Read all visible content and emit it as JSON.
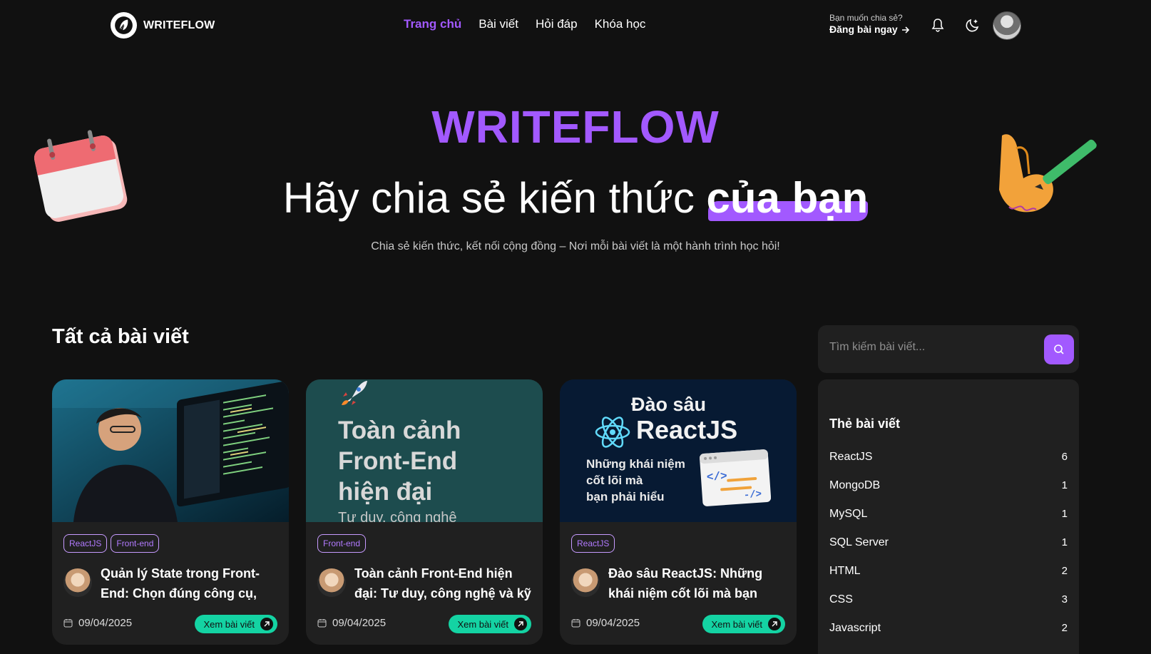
{
  "header": {
    "logo_text": "WRITEFLOW",
    "nav": [
      {
        "label": "Trang chủ",
        "active": true
      },
      {
        "label": "Bài viết",
        "active": false
      },
      {
        "label": "Hỏi đáp",
        "active": false
      },
      {
        "label": "Khóa học",
        "active": false
      }
    ],
    "share_question": "Bạn muốn chia sẻ?",
    "share_cta": "Đăng bài ngay",
    "icons": [
      "bell-icon",
      "theme-toggle-icon",
      "user-avatar"
    ]
  },
  "hero": {
    "brand": "WRITEFLOW",
    "title_part1": "Hãy chia sẻ kiến thức ",
    "title_highlight": "của bạn",
    "subtitle": "Chia sẻ kiến thức, kết nối cộng đồng – Nơi mỗi bài viết là một hành trình học hỏi!"
  },
  "section": {
    "title": "Tất cả bài viết"
  },
  "posts": [
    {
      "tags": [
        "ReactJS",
        "Front-end"
      ],
      "title": "Quản lý State trong Front-End: Chọn đúng công cụ, đúng thời điểm",
      "date": "09/04/2025",
      "button": "Xem bài viết"
    },
    {
      "tags": [
        "Front-end"
      ],
      "title": "Toàn cảnh Front-End hiện đại: Tư duy, công nghệ và kỹ năng",
      "date": "09/04/2025",
      "button": "Xem bài viết",
      "thumb": {
        "line1": "Toàn cảnh",
        "line2": "Front-End",
        "line3": "hiện đại",
        "line4": "Tư duy, công nghệ"
      }
    },
    {
      "tags": [
        "ReactJS"
      ],
      "title": "Đào sâu ReactJS: Những khái niệm cốt lõi mà bạn phải hiểu",
      "date": "09/04/2025",
      "button": "Xem bài viết",
      "thumb": {
        "line1": "Đào sâu",
        "line2": "ReactJS",
        "line3": "Những khái niệm",
        "line4": "cốt lõi mà",
        "line5": "bạn phải hiểu"
      }
    }
  ],
  "sidebar": {
    "search_placeholder": "Tìm kiếm bài viết...",
    "tags_title": "Thẻ bài viết",
    "tags": [
      {
        "name": "ReactJS",
        "count": "6"
      },
      {
        "name": "MongoDB",
        "count": "1"
      },
      {
        "name": "MySQL",
        "count": "1"
      },
      {
        "name": "SQL Server",
        "count": "1"
      },
      {
        "name": "HTML",
        "count": "2"
      },
      {
        "name": "CSS",
        "count": "3"
      },
      {
        "name": "Javascript",
        "count": "2"
      }
    ]
  },
  "colors": {
    "accent": "#a259ff",
    "button": "#14d3a3",
    "background": "#111111",
    "card": "#202020"
  }
}
